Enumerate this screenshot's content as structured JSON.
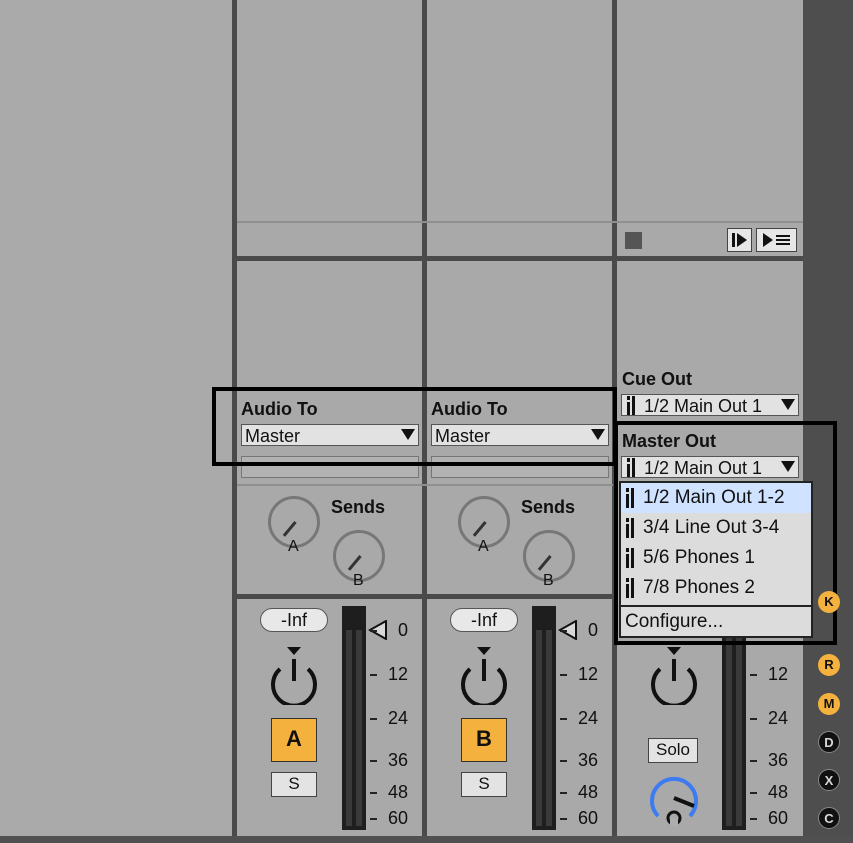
{
  "tracks": [
    {
      "audio_to_label": "Audio To",
      "audio_to_value": "Master",
      "sends_label": "Sends",
      "send_a": "A",
      "send_b": "B",
      "volume": "-Inf",
      "track_button": "A",
      "solo_button": "S"
    },
    {
      "audio_to_label": "Audio To",
      "audio_to_value": "Master",
      "sends_label": "Sends",
      "send_a": "A",
      "send_b": "B",
      "volume": "-Inf",
      "track_button": "B",
      "solo_button": "S"
    }
  ],
  "master": {
    "cue_out_label": "Cue Out",
    "cue_out_value": "1/2 Main Out 1",
    "master_out_label": "Master Out",
    "master_out_value": "1/2 Main Out 1",
    "solo_button": "Solo"
  },
  "meter_scale": [
    "0",
    "12",
    "24",
    "36",
    "48",
    "60"
  ],
  "output_menu": {
    "items": [
      {
        "label": "1/2 Main Out 1-2",
        "selected": true
      },
      {
        "label": "3/4 Line Out 3-4",
        "selected": false
      },
      {
        "label": "5/6 Phones 1",
        "selected": false
      },
      {
        "label": "7/8 Phones 2",
        "selected": false
      }
    ],
    "configure": "Configure..."
  },
  "side_buttons": [
    "K",
    "R",
    "M",
    "D",
    "X",
    "C"
  ],
  "colors": {
    "accent": "#f4b13e",
    "selection": "#cfe2ff",
    "knob_blue": "#3d7bf0"
  }
}
